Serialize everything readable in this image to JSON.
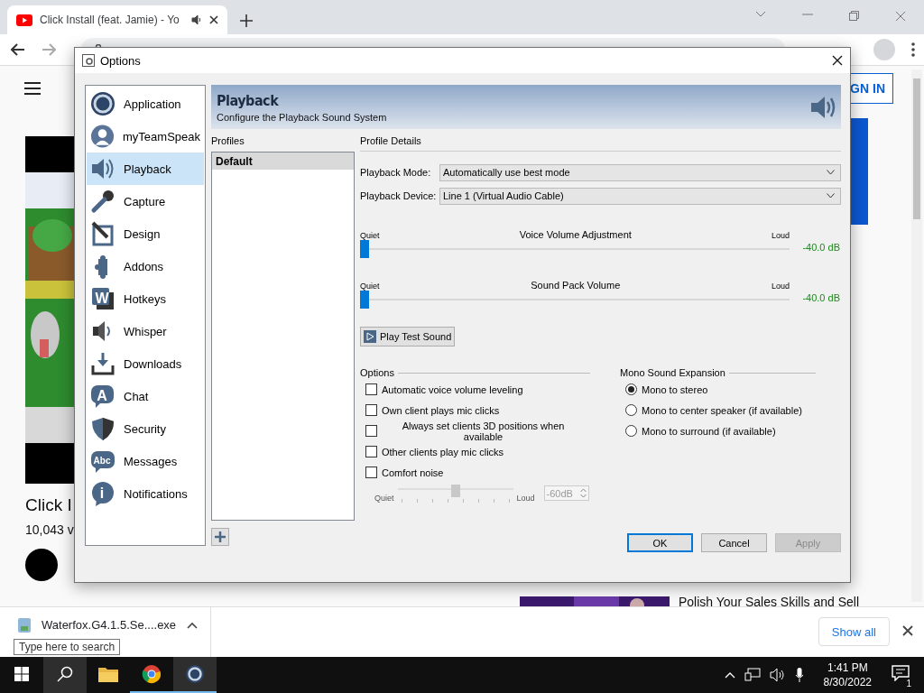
{
  "browser": {
    "tab": {
      "title": "Click Install (feat. Jamie) - Yo"
    }
  },
  "page": {
    "sign_in": "GN IN",
    "video_title": "Click I",
    "views": "10,043 v",
    "side_video_title": "Polish Your Sales Skills and Sell"
  },
  "dialog": {
    "title": "Options",
    "nav": [
      {
        "label": "Application",
        "selected": false
      },
      {
        "label": "myTeamSpeak",
        "selected": false
      },
      {
        "label": "Playback",
        "selected": true
      },
      {
        "label": "Capture",
        "selected": false
      },
      {
        "label": "Design",
        "selected": false
      },
      {
        "label": "Addons",
        "selected": false
      },
      {
        "label": "Hotkeys",
        "selected": false,
        "glyph": "W"
      },
      {
        "label": "Whisper",
        "selected": false
      },
      {
        "label": "Downloads",
        "selected": false
      },
      {
        "label": "Chat",
        "selected": false,
        "glyph": "A"
      },
      {
        "label": "Security",
        "selected": false
      },
      {
        "label": "Messages",
        "selected": false,
        "glyph": "Abc"
      },
      {
        "label": "Notifications",
        "selected": false,
        "glyph": "i"
      }
    ],
    "header": {
      "title": "Playback",
      "subtitle": "Configure the Playback Sound System"
    },
    "profiles": {
      "label": "Profiles",
      "items": [
        {
          "label": "Default",
          "selected": true
        }
      ]
    },
    "details": {
      "label": "Profile Details",
      "fields": [
        {
          "label": "Playback Mode:",
          "value": "Automatically use best mode"
        },
        {
          "label": "Playback Device:",
          "value": "Line 1 (Virtual Audio Cable)"
        }
      ],
      "sliders": [
        {
          "title": "Voice Volume Adjustment",
          "min": "Quiet",
          "max": "Loud",
          "level": 0,
          "reading": "-40.0 dB"
        },
        {
          "title": "Sound Pack Volume",
          "min": "Quiet",
          "max": "Loud",
          "level": 0,
          "reading": "-40.0 dB"
        }
      ],
      "test_button": "Play Test Sound",
      "options": {
        "title": "Options",
        "items": [
          {
            "label": "Automatic voice volume leveling",
            "checked": false
          },
          {
            "label": "Own client plays mic clicks",
            "checked": false
          },
          {
            "label": "Always set clients 3D positions when available",
            "checked": false
          },
          {
            "label": "Other clients play mic clicks",
            "checked": false
          },
          {
            "label": "Comfort noise",
            "checked": false
          }
        ]
      },
      "comfort": {
        "min": "Quiet",
        "max": "Loud",
        "level": 0.5,
        "value": "-60dB",
        "disabled": true
      },
      "mono": {
        "title": "Mono Sound Expansion",
        "items": [
          {
            "label": "Mono to stereo",
            "selected": true
          },
          {
            "label": "Mono to center speaker (if available)",
            "selected": false
          },
          {
            "label": "Mono to surround (if available)",
            "selected": false
          }
        ]
      }
    },
    "buttons": [
      {
        "label": "OK",
        "kind": "default"
      },
      {
        "label": "Cancel",
        "kind": "normal"
      },
      {
        "label": "Apply",
        "kind": "disabled"
      }
    ]
  },
  "downloads": {
    "file": "Waterfox.G4.1.5.Se....exe",
    "show_all": "Show all"
  },
  "tooltip": "Type here to search",
  "taskbar": {
    "apps": [
      {
        "kind": "search",
        "running": false,
        "active": true
      },
      {
        "kind": "folder",
        "running": false,
        "active": false
      },
      {
        "kind": "chrome",
        "running": true,
        "active": false
      },
      {
        "kind": "teamspeak",
        "running": true,
        "active": true
      }
    ],
    "time": "1:41 PM",
    "date": "8/30/2022",
    "notifications": "1"
  }
}
